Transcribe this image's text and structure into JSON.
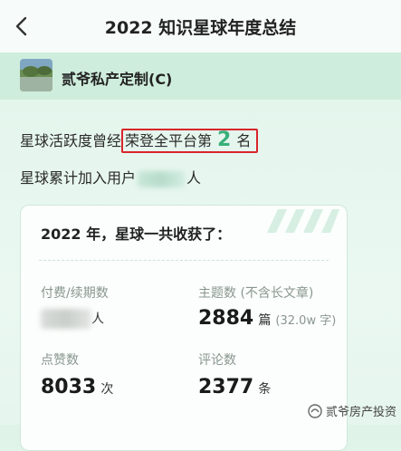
{
  "nav": {
    "title": "2022 知识星球年度总结"
  },
  "group": {
    "name": "贰爷私产定制(C)"
  },
  "activity": {
    "prefix": "星球活跃度曾经",
    "highlight_text": "荣登全平台第",
    "rank": "2",
    "suffix": "名"
  },
  "users": {
    "prefix": "星球累计加入用户",
    "suffix": "人"
  },
  "summary": {
    "title": "2022 年，星球一共收获了：",
    "paid_label": "付费/续期数",
    "paid_unit": "人",
    "topics_label": "主题数 (不含长文章)",
    "topics_value": "2884",
    "topics_unit": "篇",
    "topics_words": "(32.0w 字)",
    "likes_label": "点赞数",
    "likes_value": "8033",
    "likes_unit": "次",
    "comments_label": "评论数",
    "comments_value": "2377",
    "comments_unit": "条"
  },
  "watermark": {
    "text": "贰爷房产投资"
  },
  "colors": {
    "accent": "#39b07a",
    "highlight_border": "#d8252b"
  }
}
